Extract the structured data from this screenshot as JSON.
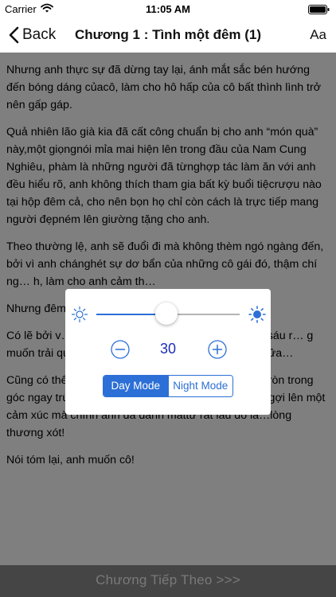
{
  "status_bar": {
    "carrier": "Carrier",
    "time": "11:05 AM"
  },
  "nav": {
    "back_label": "Back",
    "title": "Chương 1 : Tình một đêm (1)",
    "font_button": "Aa"
  },
  "content": {
    "paragraphs": [
      "Nhưng anh thực sự đã dừng tay lại, ánh mắt sắc bén hướng đến bóng dáng củacô, làm cho hô hấp của cô bất thình lình trở nên gấp gáp.",
      "Quả nhiên lão già kia đã cất công chuẩn bị cho anh “món quà” này,một giọngnói mỉa mai hiện lên trong đầu của Nam Cung Nghiêu, phàm là những người đã từnghợp tác làm ăn với anh đều hiểu rõ, anh không thích tham gia bất kỳ buổi tiệcrượu nào tại hộp đêm cả, cho nên bọn họ chỉ còn cách là trực tiếp mang người đẹpném lên giường tặng cho anh.",
      "Theo thường lệ, anh sẽ đuổi đi mà không thèm ngó ngàng đến, bởi vì anh chánghét sự dơ bẩn của những cô gái đó, thậm chí ng… h, làm cho anh cảm th…",
      "Nhưng đêm…",
      "Có lẽ bởi v… dục vọng kìm nén đã… này của mười sáu r… g muốn trải qua những ngày tháng cô đơn một mình nữa…",
      "Cũng có thể, người con gái đang run rẩy ngồi cuộn tròn trong góc ngay trướcmắt anh …đột nhiên khiến trong anh gợi lên một cảm xúc mà chính anh đã đánh mấttừ rất lâu đó là…lòng thương xót!",
      "Nói tóm lại, anh muốn cô!"
    ]
  },
  "popup": {
    "brightness": 0.49,
    "font_size_value": "30",
    "modes": {
      "day": "Day Mode",
      "night": "Night Mode",
      "selected": "day"
    }
  },
  "bottom": {
    "next_label": "Chương Tiếp Theo >>>"
  },
  "colors": {
    "accent": "#2c6fd6",
    "value_text": "#1e2fb8",
    "overlay": "rgba(0,0,0,0.5)",
    "bottom_bar": "#8a8a8a"
  },
  "icons": [
    "wifi-icon",
    "battery-icon",
    "chevron-left-icon",
    "sun-small-icon",
    "sun-large-icon",
    "minus-circle-icon",
    "plus-circle-icon"
  ]
}
